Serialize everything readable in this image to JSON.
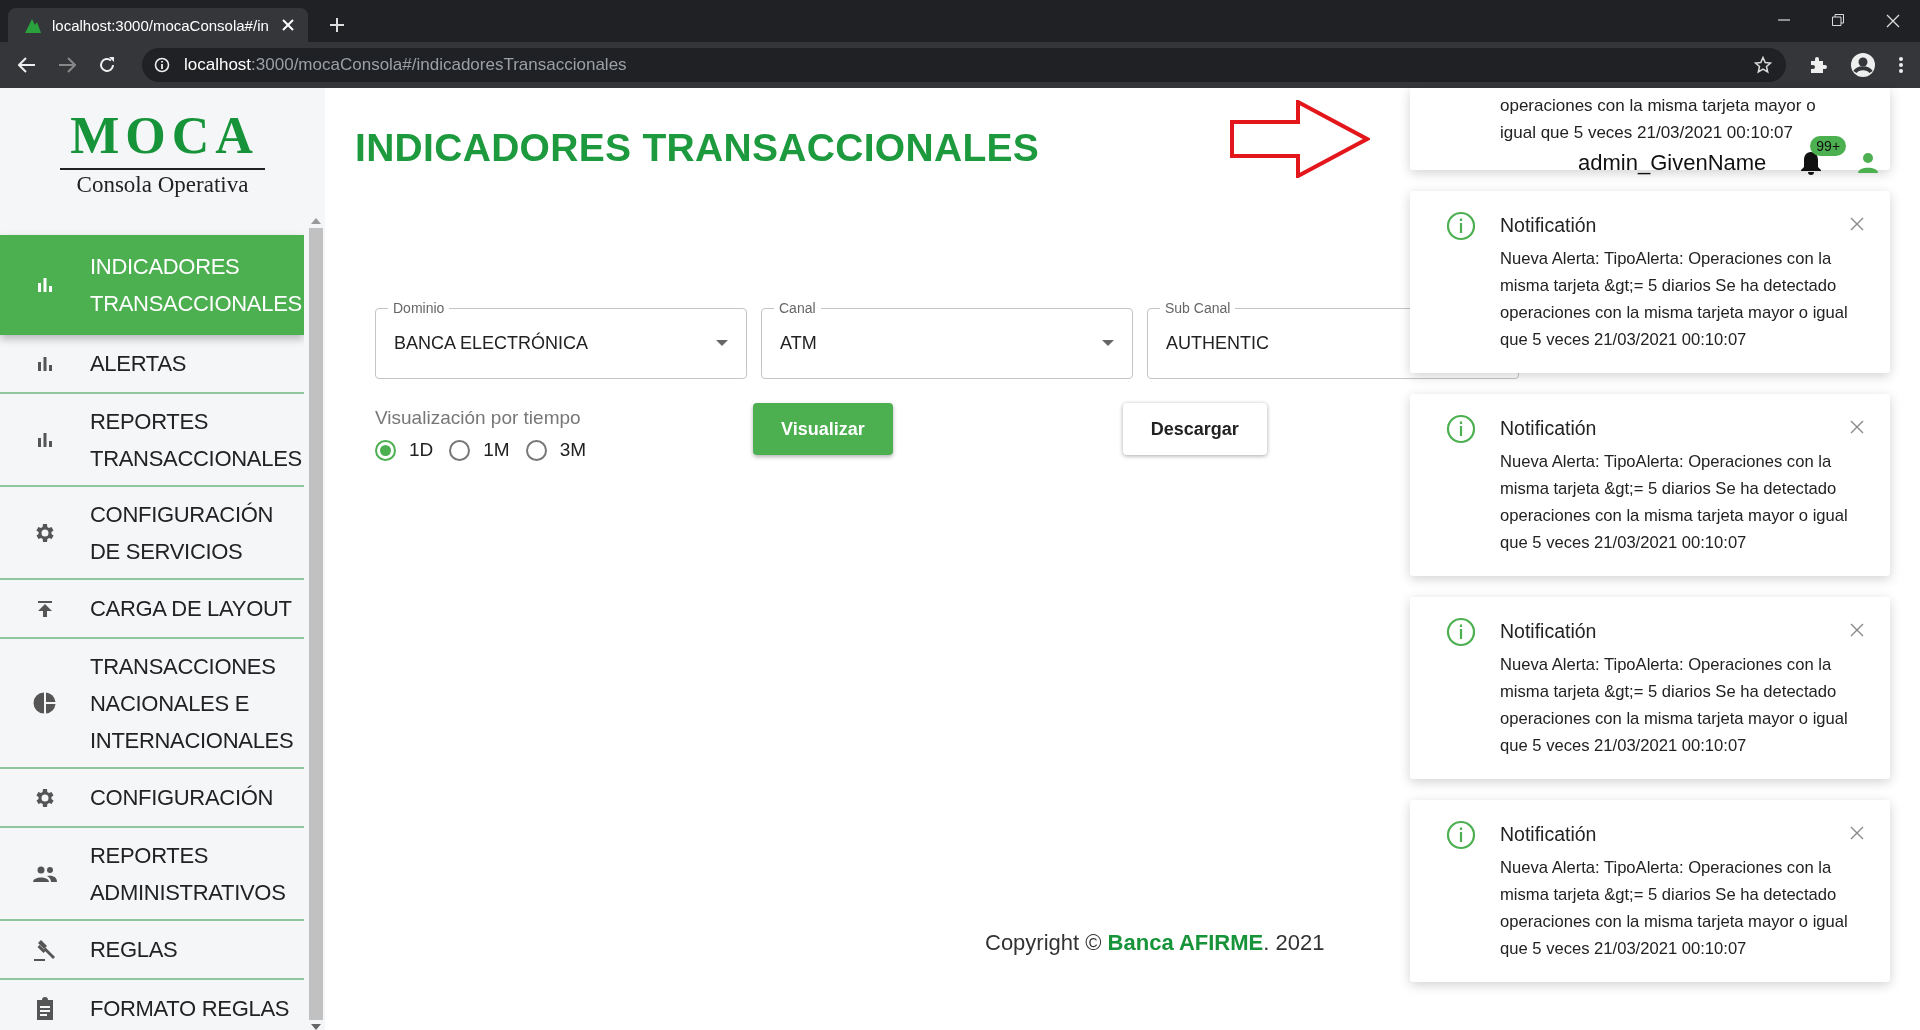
{
  "browser": {
    "tab_title": "localhost:3000/mocaConsola#/in",
    "url_host": "localhost",
    "url_rest": ":3000/mocaConsola#/indicadoresTransaccionales"
  },
  "sidebar": {
    "logo": {
      "title": "MOCA",
      "subtitle": "Consola Operativa"
    },
    "items": [
      {
        "lines": [
          "INDICADORES",
          "TRANSACCIONALES"
        ],
        "kind": "chart",
        "selected": true
      },
      {
        "lines": [
          "ALERTAS"
        ],
        "kind": "chart",
        "selected": false
      },
      {
        "lines": [
          "REPORTES",
          "TRANSACCIONALES"
        ],
        "kind": "chart",
        "selected": false
      },
      {
        "lines": [
          "CONFIGURACIÓN",
          "DE SERVICIOS"
        ],
        "kind": "settings",
        "selected": false
      },
      {
        "lines": [
          "CARGA DE LAYOUT"
        ],
        "kind": "upload",
        "selected": false
      },
      {
        "lines": [
          "TRANSACCIONES",
          "NACIONALES E",
          "INTERNACIONALES"
        ],
        "kind": "pie",
        "selected": false
      },
      {
        "lines": [
          "CONFIGURACIÓN"
        ],
        "kind": "settings",
        "selected": false
      },
      {
        "lines": [
          "REPORTES",
          "ADMINISTRATIVOS"
        ],
        "kind": "people",
        "selected": false
      },
      {
        "lines": [
          "REGLAS"
        ],
        "kind": "rules",
        "selected": false
      },
      {
        "lines": [
          "FORMATO REGLAS"
        ],
        "kind": "clipboard",
        "selected": false
      }
    ]
  },
  "main": {
    "title": "INDICADORES TRANSACCIONALES",
    "filters": [
      {
        "label": "Dominio",
        "value": "BANCA ELECTRÓNICA",
        "dropdown": true
      },
      {
        "label": "Canal",
        "value": "ATM",
        "dropdown": true
      },
      {
        "label": "Sub Canal",
        "value": "AUTHENTIC",
        "dropdown": false
      }
    ],
    "time": {
      "label": "Visualización por tiempo",
      "options": [
        {
          "label": "1D",
          "selected": true
        },
        {
          "label": "1M",
          "selected": false
        },
        {
          "label": "3M",
          "selected": false
        }
      ]
    },
    "buttons": [
      {
        "label": "Visualizar",
        "kind": "primary"
      },
      {
        "label": "Descargar",
        "kind": "secondary"
      }
    ],
    "footer": "Copyright © **Banca AFIRME**. 2021"
  },
  "header": {
    "user": "admin_GivenName",
    "badge": "99+"
  },
  "notifications": {
    "partial_lines": [
      "operaciones con la misma tarjeta mayor o",
      "igual que 5 veces 21/03/2021 00:10:07"
    ],
    "items": [
      {
        "title": "Notificatión",
        "message": "Nueva Alerta: TipoAlerta: Operaciones con la misma tarjeta &gt;= 5 diarios Se ha detectado operaciones con la misma tarjeta mayor o igual que 5 veces 21/03/2021 00:10:07"
      },
      {
        "title": "Notificatión",
        "message": "Nueva Alerta: TipoAlerta: Operaciones con la misma tarjeta &gt;= 5 diarios Se ha detectado operaciones con la misma tarjeta mayor o igual que 5 veces 21/03/2021 00:10:07"
      },
      {
        "title": "Notificatión",
        "message": "Nueva Alerta: TipoAlerta: Operaciones con la misma tarjeta &gt;= 5 diarios Se ha detectado operaciones con la misma tarjeta mayor o igual que 5 veces 21/03/2021 00:10:07"
      },
      {
        "title": "Notificatión",
        "message": "Nueva Alerta: TipoAlerta: Operaciones con la misma tarjeta &gt;= 5 diarios Se ha detectado operaciones con la misma tarjeta mayor o igual que 5 veces 21/03/2021 00:10:07"
      }
    ]
  }
}
